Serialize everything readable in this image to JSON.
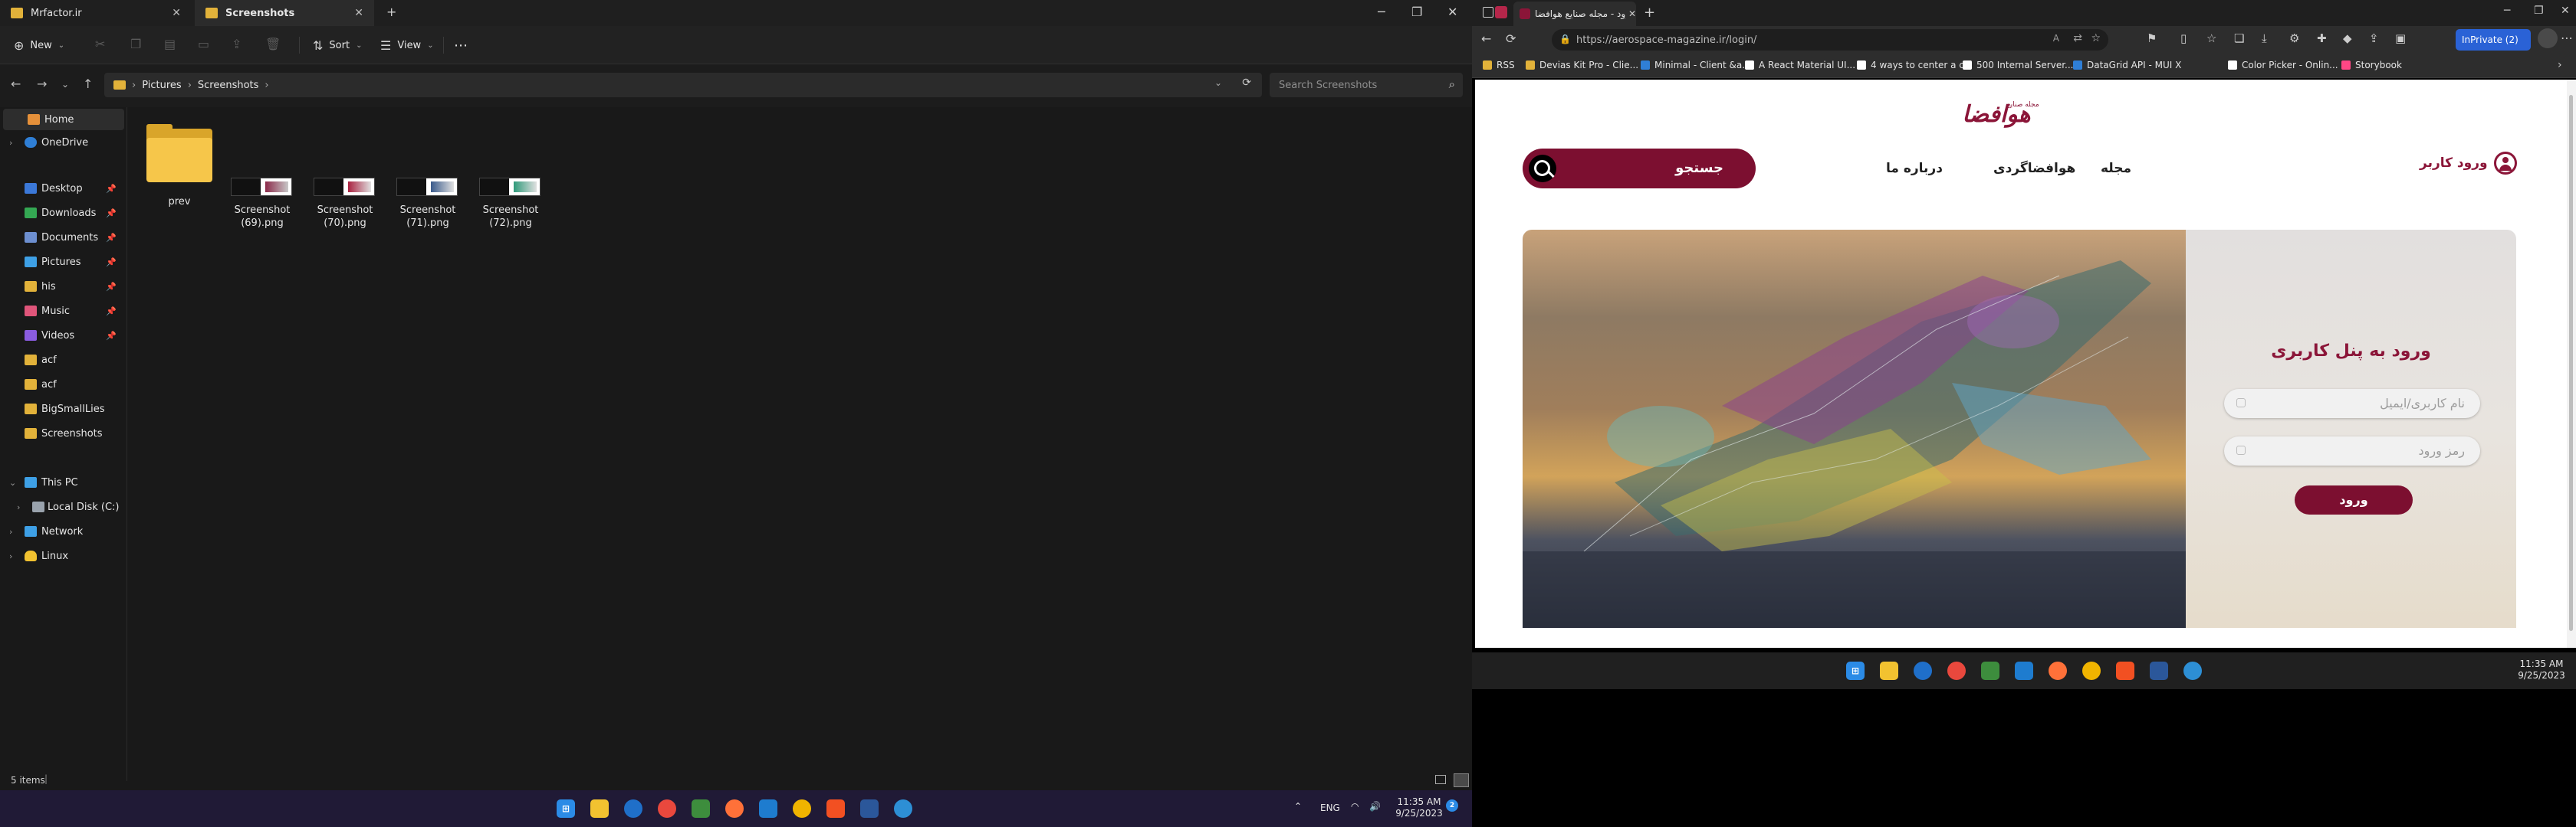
{
  "explorer": {
    "tabs": [
      {
        "label": "Mrfactor.ir",
        "color": "#e2b23a"
      },
      {
        "label": "Screenshots",
        "color": "#e2b23a"
      }
    ],
    "toolbar": {
      "new_label": "New",
      "sort_label": "Sort",
      "view_label": "View",
      "more_icon": "ellipsis-icon"
    },
    "breadcrumb": [
      "Pictures",
      "Screenshots"
    ],
    "search_placeholder": "Search Screenshots",
    "sidebar": [
      {
        "label": "Home",
        "icon": "home-icon",
        "color": "#e5903a"
      },
      {
        "label": "OneDrive",
        "icon": "cloud-icon",
        "color": "#2f7fd6"
      },
      {
        "label": "Desktop",
        "icon": "desktop-icon",
        "color": "#3b78d8"
      },
      {
        "label": "Downloads",
        "icon": "download-icon",
        "color": "#34a853"
      },
      {
        "label": "Documents",
        "icon": "document-icon",
        "color": "#6d8fd0"
      },
      {
        "label": "Pictures",
        "icon": "picture-icon",
        "color": "#3ea0e6"
      },
      {
        "label": "his",
        "icon": "folder-icon",
        "color": "#e2b23a"
      },
      {
        "label": "Music",
        "icon": "music-icon",
        "color": "#e0557a"
      },
      {
        "label": "Videos",
        "icon": "video-icon",
        "color": "#8a5ce0"
      },
      {
        "label": "acf",
        "icon": "folder-icon",
        "color": "#e2b23a"
      },
      {
        "label": "acf",
        "icon": "folder-icon",
        "color": "#e2b23a"
      },
      {
        "label": "BigSmallLies",
        "icon": "folder-icon",
        "color": "#e2b23a"
      },
      {
        "label": "Screenshots",
        "icon": "folder-icon",
        "color": "#e2b23a"
      },
      {
        "label": "This PC",
        "icon": "pc-icon",
        "color": "#3ea0e6"
      },
      {
        "label": "Local Disk (C:)",
        "icon": "disk-icon",
        "color": "#9aa3ad"
      },
      {
        "label": "Network",
        "icon": "network-icon",
        "color": "#3ea0e6"
      },
      {
        "label": "Linux",
        "icon": "linux-icon",
        "color": "#f2c230"
      }
    ],
    "files": [
      {
        "name": "prev",
        "kind": "folder"
      },
      {
        "name": "Screenshot (69).png",
        "kind": "image"
      },
      {
        "name": "Screenshot (70).png",
        "kind": "image"
      },
      {
        "name": "Screenshot (71).png",
        "kind": "image"
      },
      {
        "name": "Screenshot (72).png",
        "kind": "image"
      }
    ],
    "status": "5 items"
  },
  "taskbar_left": {
    "time": "11:35 AM",
    "date": "9/25/2023",
    "lang": "ENG"
  },
  "browser": {
    "tab_title": "ورود - مجله صنایع هوافضا",
    "url": "https://aerospace-magazine.ir/login/",
    "inprivate_label": "InPrivate (2)",
    "bookmarks": [
      {
        "label": "RSS",
        "color": "#e2b23a"
      },
      {
        "label": "Devias Kit Pro - Clie...",
        "color": "#e2b23a"
      },
      {
        "label": "Minimal - Client &a...",
        "color": "#2f7fd6"
      },
      {
        "label": "A React Material UI...",
        "color": "#ffffff"
      },
      {
        "label": "4 ways to center a c...",
        "color": "#ffffff"
      },
      {
        "label": "500 Internal Server...",
        "color": "#ffffff"
      },
      {
        "label": "DataGrid API - MUI X",
        "color": "#2f7fd6"
      },
      {
        "label": "Color Picker - Onlin...",
        "color": "#ffffff"
      },
      {
        "label": "Storybook",
        "color": "#ff4785"
      }
    ]
  },
  "site": {
    "logo_text": "هوافضا",
    "logo_small": "مجله صنایع",
    "search_placeholder": "جستجو",
    "nav": [
      "مجله",
      "هوافضاگردی",
      "درباره ما"
    ],
    "login_link": "ورود کاربر",
    "login_title": "ورود به پنل کاربری",
    "username_placeholder": "نام کاربری/ایمیل",
    "password_placeholder": "رمز ورود",
    "login_button": "ورود",
    "accent": "#8b1538"
  },
  "taskbar_right": {
    "time": "11:35 AM",
    "date": "9/25/2023"
  }
}
